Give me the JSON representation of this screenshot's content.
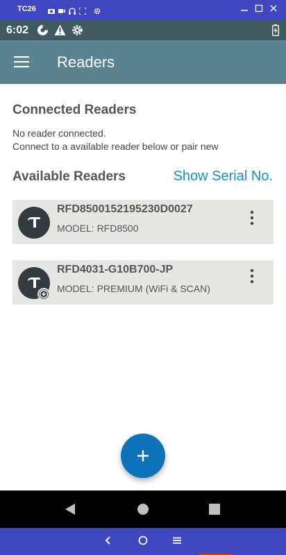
{
  "emulator": {
    "title": "TC26",
    "icons": [
      "camera-icon",
      "video-icon",
      "headphones-icon",
      "fullscreen-icon",
      "settings-icon"
    ],
    "controls": [
      "minimize-icon",
      "maximize-icon",
      "close-icon"
    ],
    "nav": [
      "back-icon",
      "home-icon",
      "menu-icon"
    ]
  },
  "status_bar": {
    "time": "6:02",
    "icons": [
      "data-saver-icon",
      "warning-icon",
      "settings-icon"
    ],
    "battery": "battery-charging-icon"
  },
  "app_bar": {
    "title": "Readers",
    "menu_icon": "hamburger-menu-icon"
  },
  "connected": {
    "title": "Connected Readers",
    "line1": "No reader connected.",
    "line2": "Connect to a available reader below or pair new"
  },
  "available": {
    "title": "Available Readers",
    "show_serial": "Show Serial No.",
    "readers": [
      {
        "name": "RFD8500152195230D0027",
        "model": "MODEL: RFD8500"
      },
      {
        "name": "RFD4031-G10B700-JP",
        "model": "MODEL: PREMIUM (WiFi & SCAN)"
      }
    ]
  },
  "fab": {
    "icon": "plus-icon"
  },
  "colors": {
    "app_bar": "#5a8291",
    "status_bar": "#3f5a5e",
    "emulator_bar": "#3f46c0",
    "accent": "#1a8fbf",
    "fab": "#0e73b8",
    "card": "#e6e7e5",
    "avatar": "#333b40"
  }
}
